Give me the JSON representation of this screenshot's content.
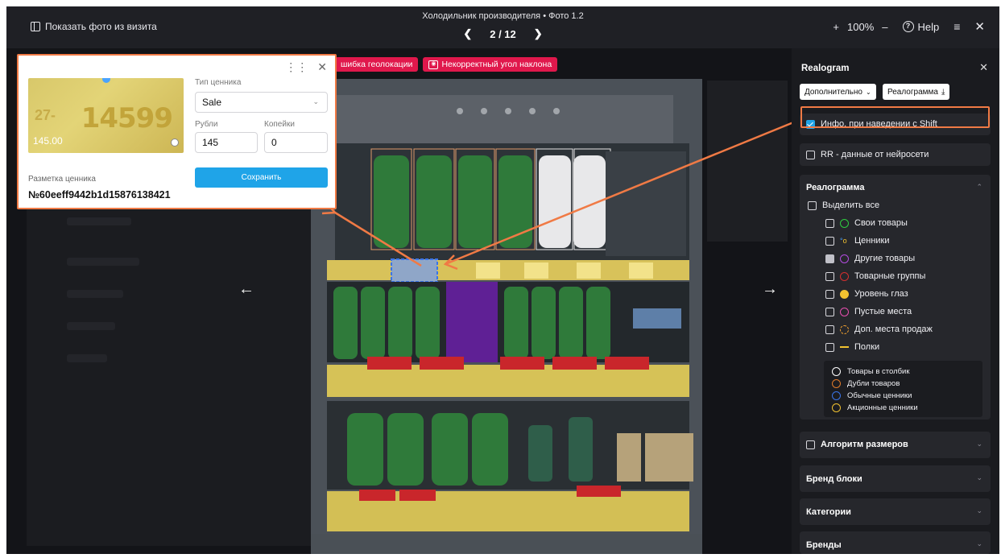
{
  "topbar": {
    "show_photos": "Показать фото из визита",
    "title": "Холодильник производителя • Фото 1.2",
    "pager": "2 / 12",
    "zoom": "100%",
    "help": "Help"
  },
  "tags": [
    {
      "label": "шибка геолокации"
    },
    {
      "label": "Некорректный угол наклона"
    }
  ],
  "popup": {
    "thumb_price": "14599",
    "thumb_old": "145.00",
    "thumb_small": "27-",
    "price_type_label": "Тип ценника",
    "price_type_value": "Sale",
    "rubles_label": "Рубли",
    "rubles_value": "145",
    "kopecks_label": "Копейки",
    "kopecks_value": "0",
    "save_label": "Сохранить",
    "markup_label": "Разметка ценника",
    "markup_id": "№60eeff9442b1d15876138421"
  },
  "sidebar": {
    "title": "Realogram",
    "btn_more": "Дополнительно",
    "btn_realogram": "Реалограмма",
    "shift_info": "Инфо. при наведении с Shift",
    "rr_data": "RR - данные от нейросети",
    "realogram_section": "Реалограмма",
    "select_all": "Выделить все",
    "items": [
      {
        "label": "Свои товары",
        "color": "#2ecc40",
        "kind": "ring"
      },
      {
        "label": "Ценники",
        "color": "#4aa3ff",
        "kind": "tags"
      },
      {
        "label": "Другие товары",
        "color": "#b44ce0",
        "kind": "ring"
      },
      {
        "label": "Товарные группы",
        "color": "#d32f2f",
        "kind": "ring"
      },
      {
        "label": "Уровень глаз",
        "color": "#f2c230",
        "kind": "dot"
      },
      {
        "label": "Пустые места",
        "color": "#e84fb0",
        "kind": "ring"
      },
      {
        "label": "Доп. места продаж",
        "color": "#f0a030",
        "kind": "dashed"
      },
      {
        "label": "Полки",
        "color": "#f2c230",
        "kind": "line"
      }
    ],
    "legend": [
      {
        "label": "Товары в столбик",
        "color": "#ffffff"
      },
      {
        "label": "Дубли товаров",
        "color": "#e07b2a"
      },
      {
        "label": "Обычные ценники",
        "color": "#3a74e8"
      },
      {
        "label": "Акционные ценники",
        "color": "#f2c230"
      }
    ],
    "size_algo": "Алгоритм размеров",
    "brand_blocks": "Бренд блоки",
    "categories": "Категории",
    "brands": "Бренды"
  },
  "colors": {
    "accent": "#1fa4e8",
    "highlight": "#f07a45",
    "tag": "#e0184c"
  }
}
